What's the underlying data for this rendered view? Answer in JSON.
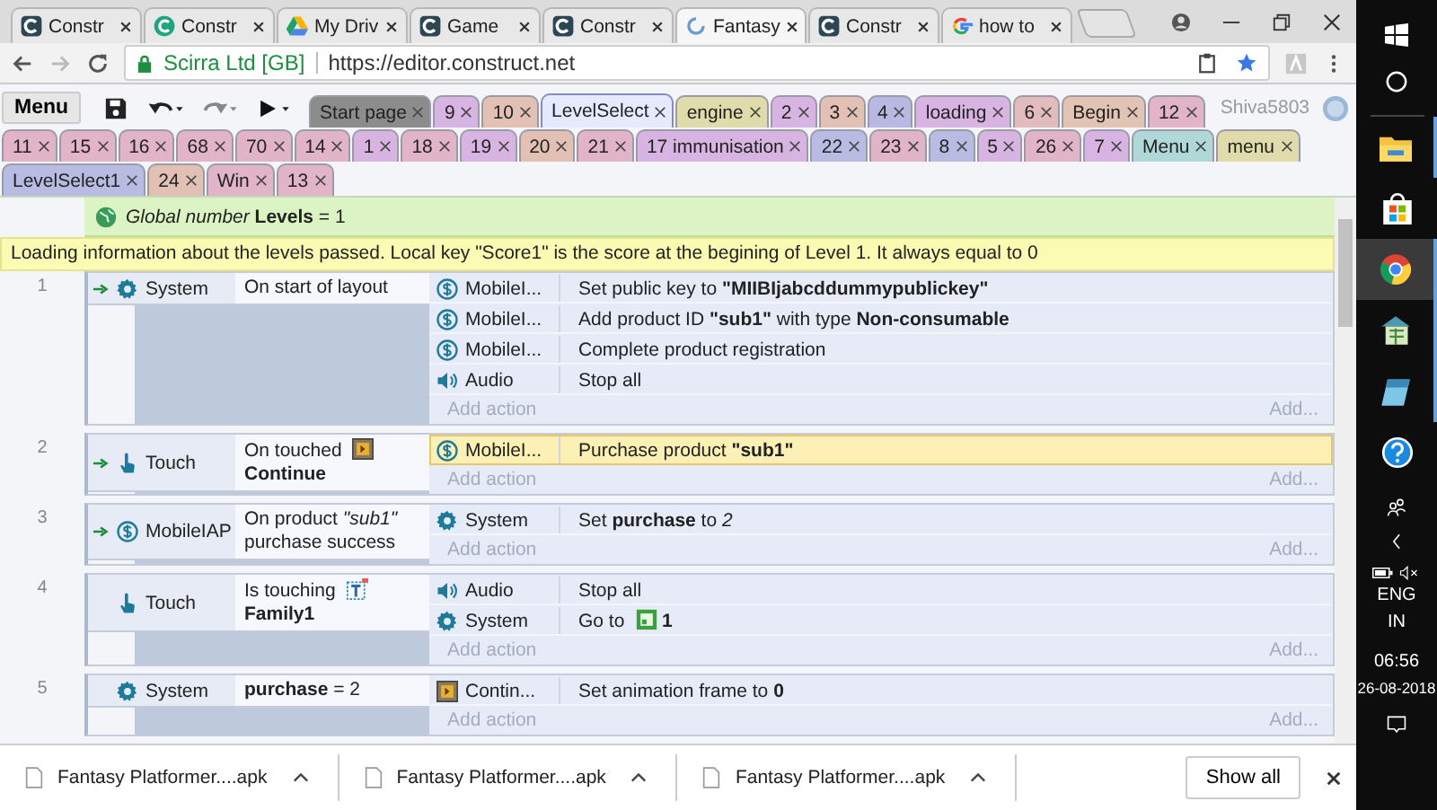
{
  "browser_tabs": [
    {
      "title": "Constr",
      "kind": "construct",
      "selected": false
    },
    {
      "title": "Constr",
      "kind": "construct-green",
      "selected": false
    },
    {
      "title": "My Driv",
      "kind": "drive",
      "selected": false
    },
    {
      "title": "Game",
      "kind": "construct",
      "selected": false
    },
    {
      "title": "Constr",
      "kind": "construct",
      "selected": false
    },
    {
      "title": "Fantasy",
      "kind": "loading",
      "selected": true
    },
    {
      "title": "Constr",
      "kind": "construct",
      "selected": false
    },
    {
      "title": "how to",
      "kind": "google",
      "selected": false
    }
  ],
  "address_bar": {
    "site": "Scirra Ltd [GB]",
    "url": "https://editor.construct.net"
  },
  "editor_toolbar": {
    "menu": "Menu",
    "user": "Shiva5803"
  },
  "sheet_tab_rows": [
    [
      {
        "label": "Start page",
        "color": "#8c8c8c",
        "selected": false
      },
      {
        "label": "9",
        "color": "#d8b4e2",
        "selected": false
      },
      {
        "label": "10",
        "color": "#e2c0b4",
        "selected": false
      },
      {
        "label": "LevelSelect",
        "color": "#e6eaff",
        "selected": true
      },
      {
        "label": "engine",
        "color": "#e0dbaa",
        "selected": false
      },
      {
        "label": "2",
        "color": "#d8b4e2",
        "selected": false
      },
      {
        "label": "3",
        "color": "#e2c0b4",
        "selected": false
      },
      {
        "label": "4",
        "color": "#b8b8e2",
        "selected": false
      },
      {
        "label": "loading",
        "color": "#d8b4e2",
        "selected": false
      },
      {
        "label": "6",
        "color": "#e2bcbc",
        "selected": false
      },
      {
        "label": "Begin",
        "color": "#e2c4b4",
        "selected": false
      },
      {
        "label": "12",
        "color": "#e2b4c8",
        "selected": false
      }
    ],
    [
      {
        "label": "11",
        "color": "#e2b4c8",
        "selected": false
      },
      {
        "label": "15",
        "color": "#e2b4c8",
        "selected": false
      },
      {
        "label": "16",
        "color": "#e2b4c8",
        "selected": false
      },
      {
        "label": "68",
        "color": "#e2b4c8",
        "selected": false
      },
      {
        "label": "70",
        "color": "#e2b4c8",
        "selected": false
      },
      {
        "label": "14",
        "color": "#e2b4c8",
        "selected": false
      },
      {
        "label": "1",
        "color": "#d8b4e2",
        "selected": false
      },
      {
        "label": "18",
        "color": "#e2b4c8",
        "selected": false
      },
      {
        "label": "19",
        "color": "#d8b4e2",
        "selected": false
      },
      {
        "label": "20",
        "color": "#e2c0b4",
        "selected": false
      },
      {
        "label": "21",
        "color": "#e2b4c8",
        "selected": false
      },
      {
        "label": "17 immunisation",
        "color": "#d8b4e2",
        "selected": false
      },
      {
        "label": "22",
        "color": "#b8bce2",
        "selected": false
      },
      {
        "label": "23",
        "color": "#e2b4c8",
        "selected": false
      },
      {
        "label": "8",
        "color": "#b8bce2",
        "selected": false
      },
      {
        "label": "5",
        "color": "#d8b4e2",
        "selected": false
      },
      {
        "label": "26",
        "color": "#e2b4c8",
        "selected": false
      },
      {
        "label": "7",
        "color": "#d8b4e2",
        "selected": false
      },
      {
        "label": "Menu",
        "color": "#b0d8d8",
        "selected": false
      },
      {
        "label": "menu",
        "color": "#e0dbaa",
        "selected": false
      }
    ],
    [
      {
        "label": "LevelSelect1",
        "color": "#b8bce2",
        "selected": false
      },
      {
        "label": "24",
        "color": "#e2c0b4",
        "selected": false
      },
      {
        "label": "Win",
        "color": "#e2b4c8",
        "selected": false
      },
      {
        "label": "13",
        "color": "#e2b4c8",
        "selected": false
      }
    ]
  ],
  "global_variable": "*Global number* **Levels** = 1",
  "comment": "Loading information about the levels passed. Local key \"Score1\" is the score at the begining of Level 1. It always equal to 0",
  "events": [
    {
      "number": "1",
      "trigger": true,
      "object": {
        "name": "System",
        "kind": "system"
      },
      "condition": [
        {
          "kind": "text",
          "text": "On start of layout"
        }
      ],
      "actions": [
        {
          "object": "MobileI...",
          "kind": "iap",
          "text": [
            {
              "kind": "text",
              "text": "Set public key to **\"MIIBIjabcddummypublickey\"**"
            }
          ],
          "selected": false
        },
        {
          "object": "MobileI...",
          "kind": "iap",
          "text": [
            {
              "kind": "text",
              "text": "Add product ID **\"sub1\"** with type **Non-consumable**"
            }
          ],
          "selected": false
        },
        {
          "object": "MobileI...",
          "kind": "iap",
          "text": [
            {
              "kind": "text",
              "text": "Complete product registration"
            }
          ],
          "selected": false
        },
        {
          "object": "Audio",
          "kind": "audio",
          "text": [
            {
              "kind": "text",
              "text": "Stop all"
            }
          ],
          "selected": false
        }
      ],
      "add_action": "Add action",
      "add_more": "Add..."
    },
    {
      "number": "2",
      "trigger": true,
      "object": {
        "name": "Touch",
        "kind": "touch"
      },
      "condition": [
        {
          "kind": "text",
          "text": "On touched"
        },
        {
          "kind": "sprite"
        },
        {
          "kind": "text",
          "text": "**Continue**"
        }
      ],
      "actions": [
        {
          "object": "MobileI...",
          "kind": "iap",
          "text": [
            {
              "kind": "text",
              "text": "Purchase product **\"sub1\"**"
            }
          ],
          "selected": true
        }
      ],
      "add_action": "Add action",
      "add_more": "Add..."
    },
    {
      "number": "3",
      "trigger": true,
      "object": {
        "name": "MobileIAP",
        "kind": "iap"
      },
      "condition": [
        {
          "kind": "text",
          "text": "On product *\"sub1\"* purchase success"
        }
      ],
      "actions": [
        {
          "object": "System",
          "kind": "system",
          "text": [
            {
              "kind": "text",
              "text": "Set **purchase** to *2*"
            }
          ],
          "selected": false
        }
      ],
      "add_action": "Add action",
      "add_more": "Add..."
    },
    {
      "number": "4",
      "trigger": false,
      "object": {
        "name": "Touch",
        "kind": "touch"
      },
      "condition": [
        {
          "kind": "text",
          "text": "Is touching"
        },
        {
          "kind": "family"
        },
        {
          "kind": "text",
          "text": "**Family1**"
        }
      ],
      "actions": [
        {
          "object": "Audio",
          "kind": "audio",
          "text": [
            {
              "kind": "text",
              "text": "Stop all"
            }
          ],
          "selected": false
        },
        {
          "object": "System",
          "kind": "system",
          "text": [
            {
              "kind": "text",
              "text": "Go to"
            },
            {
              "kind": "layout"
            },
            {
              "kind": "text",
              "text": "**1**"
            }
          ],
          "selected": false
        }
      ],
      "add_action": "Add action",
      "add_more": "Add..."
    },
    {
      "number": "5",
      "trigger": false,
      "object": {
        "name": "System",
        "kind": "system"
      },
      "condition": [
        {
          "kind": "text",
          "text": "**purchase** = 2"
        }
      ],
      "actions": [
        {
          "object": "Contin...",
          "kind": "sprite",
          "text": [
            {
              "kind": "text",
              "text": "Set animation frame to **0**"
            }
          ],
          "selected": false
        }
      ],
      "add_action": "Add action",
      "add_more": "Add..."
    }
  ],
  "downloads": [
    {
      "name": "Fantasy Platformer....apk"
    },
    {
      "name": "Fantasy Platformer....apk"
    },
    {
      "name": "Fantasy Platformer....apk"
    }
  ],
  "show_all": "Show all",
  "taskbar": {
    "language": "ENG",
    "region": "IN",
    "time": "06:56",
    "date": "26-08-2018"
  }
}
